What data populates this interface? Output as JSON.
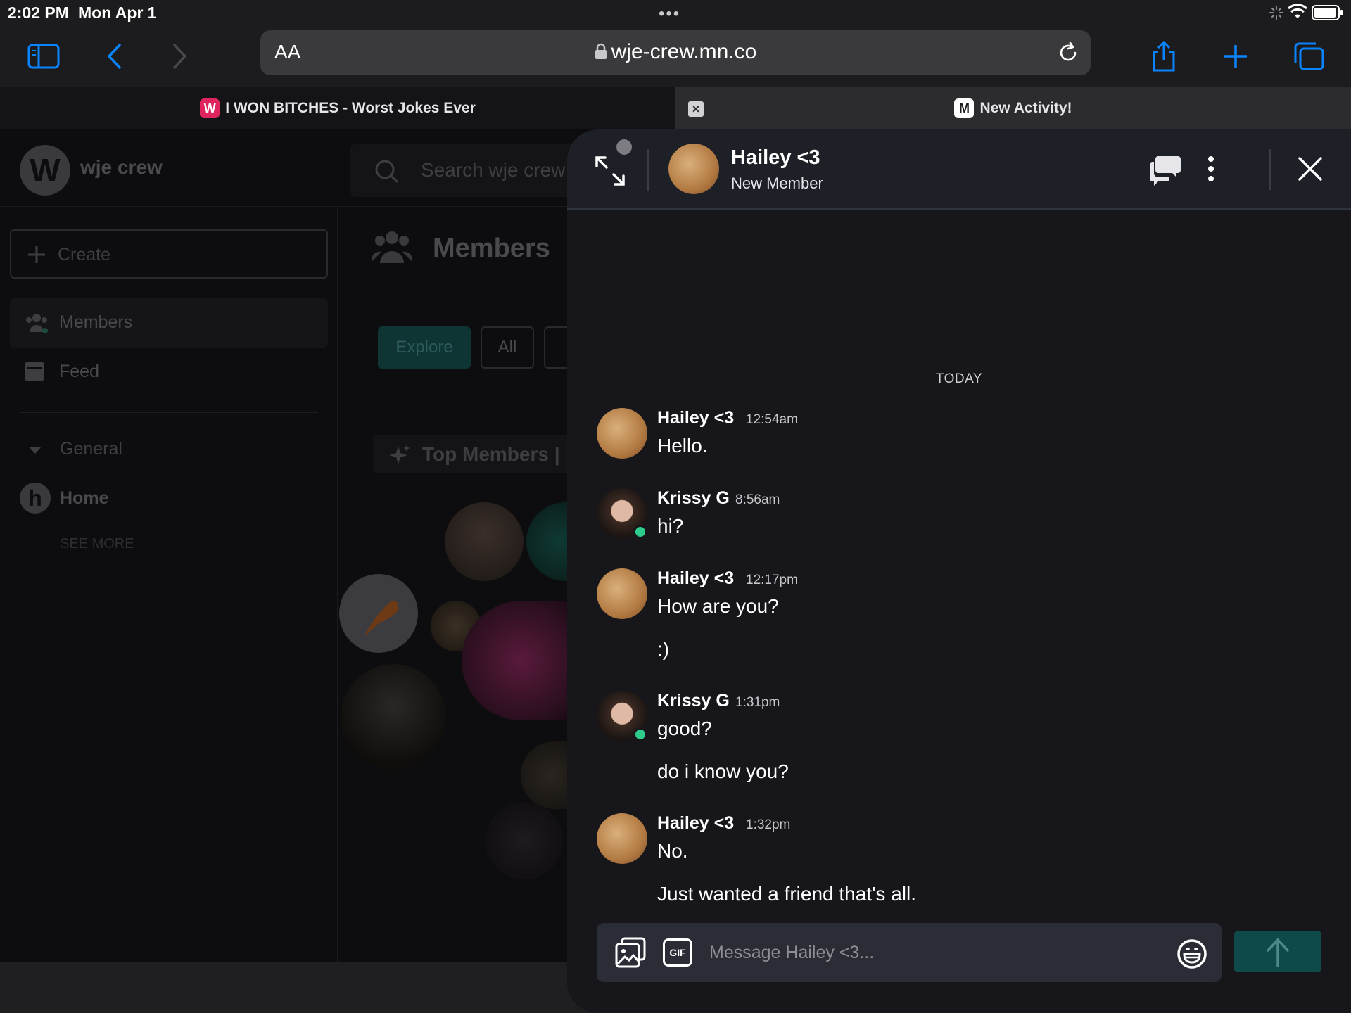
{
  "status_bar": {
    "time": "2:02 PM",
    "date": "Mon Apr 1",
    "dots": "•••"
  },
  "toolbar": {
    "text_size": "AA",
    "url": "wje-crew.mn.co"
  },
  "tabs": [
    {
      "title": "I WON BITCHES - Worst Jokes Ever",
      "favicon": "W",
      "favicon_color": "#e0245e"
    },
    {
      "title": "New Activity!",
      "favicon": "M",
      "favicon_color": "#ffffff"
    }
  ],
  "tab_close": "×",
  "background_page": {
    "logo": "W",
    "brand": "wje crew",
    "search_placeholder": "Search wje crew",
    "create_label": "Create",
    "nav": {
      "members": "Members",
      "feed": "Feed"
    },
    "general": "General",
    "home_icon": "h",
    "home": "Home",
    "see_more": "SEE MORE",
    "content_title": "Members",
    "chips": {
      "explore": "Explore",
      "all": "All"
    },
    "top_members": "Top Members |"
  },
  "chat": {
    "name": "Hailey <3",
    "subtitle": "New Member",
    "day_label": "TODAY",
    "messages": [
      {
        "author": "Hailey <3",
        "time": "12:54am",
        "lines": [
          "Hello."
        ]
      },
      {
        "author": "Krissy G",
        "time": "8:56am",
        "lines": [
          "hi?"
        ]
      },
      {
        "author": "Hailey <3",
        "time": "12:17pm",
        "lines": [
          "How are you?",
          ":)"
        ]
      },
      {
        "author": "Krissy G",
        "time": "1:31pm",
        "lines": [
          "good?",
          "do i know you?"
        ]
      },
      {
        "author": "Hailey <3",
        "time": "1:32pm",
        "lines": [
          "No.",
          "Just wanted a friend that's all."
        ]
      }
    ],
    "composer": {
      "gif_label": "GIF",
      "placeholder": "Message Hailey <3..."
    }
  },
  "colors": {
    "accent": "#0e4a4a",
    "online": "#2ecc8a",
    "ios_blue": "#0a84ff"
  }
}
